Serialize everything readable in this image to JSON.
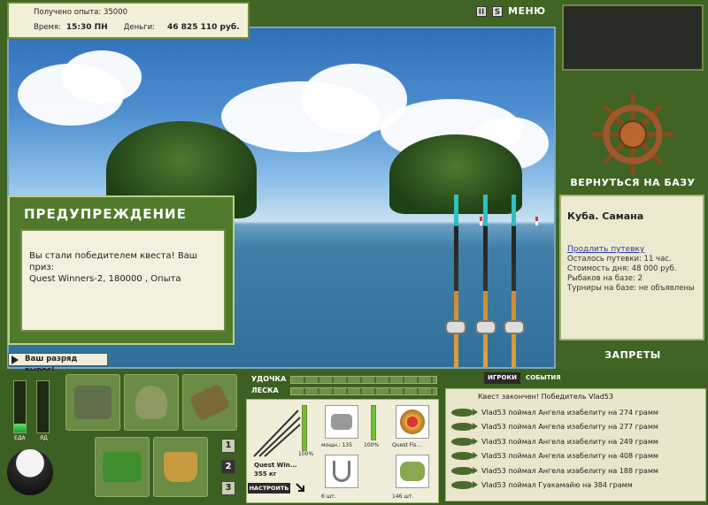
{
  "top_info": {
    "exp_label": "Получено опыта:",
    "exp_value": "35000",
    "time_label": "Время:",
    "time_value": "15:30 ПН",
    "money_label": "Деньги:",
    "money_value": "46 825 110 руб."
  },
  "header": {
    "btn_pause": "II",
    "btn_sound": "S",
    "menu_label": "МЕНЮ"
  },
  "sidebar": {
    "return_label": "ВЕРНУТЬСЯ НА БАЗУ",
    "place_name": "Куба. Самана",
    "extend_link": "Продлить путевку",
    "lines": [
      "Осталось путевки: 11 час.",
      "Стоимость дня: 48 000 руб.",
      "Рыбаков на базе: 2",
      "Турниры на базе: не объявлены"
    ],
    "bans_label": "ЗАПРЕТЫ"
  },
  "warning": {
    "title": "ПРЕДУПРЕЖДЕНИЕ",
    "message_line1": "Вы стали победителем квеста! Ваш приз:",
    "message_line2": "Quest Winners-2, 180000 , Опыта"
  },
  "rank": {
    "label": "Ваш разряд вырос!"
  },
  "meters": {
    "food_label": "ЕДА",
    "poison_label": "ЯД",
    "food_level": 0.18,
    "poison_level": 0.0
  },
  "inventory": {
    "tabs": [
      "1",
      "2",
      "3"
    ],
    "active_tab": 1
  },
  "tackle": {
    "rod_label": "УДОЧКА",
    "line_label": "ЛЕСКА",
    "rod_name": "Quest Win...",
    "rod_weight": "355 кг",
    "rod_percent": "100%",
    "reel_power": "мощн.: 135",
    "reel_percent": "100%",
    "line_name": "Quest Fis...",
    "hooks_count": "6 шт.",
    "bait_count": "146 шт.",
    "setup_label": "НАСТРОИТЬ"
  },
  "events": {
    "tab_players": "ИГРОКИ",
    "tab_events": "СОБЫТИЯ",
    "header": "Квест закончен! Победитель Vlad53",
    "rows": [
      "Vlad53 поймал Ангела изабелиту на 274 грамм",
      "Vlad53 поймал Ангела изабелиту на 277 грамм",
      "Vlad53 поймал Ангела изабелиту на 249 грамм",
      "Vlad53 поймал Ангела изабелиту на 408 грамм",
      "Vlad53 поймал Ангела изабелиту на 188 грамм",
      "Vlad53 поймал Гуакамайю на 384 грамм"
    ]
  },
  "colors": {
    "bg_green": "#3f6424",
    "panel_cream": "#ede9ce",
    "link_blue": "#2a3cae"
  }
}
